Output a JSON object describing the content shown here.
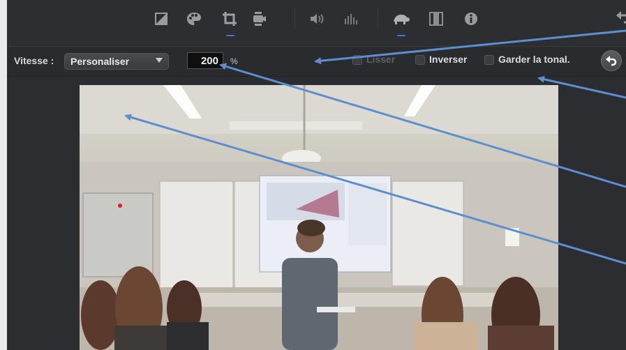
{
  "toolbar": {
    "icons": [
      "color-balance-icon",
      "color-palette-icon",
      "crop-icon",
      "stabilization-camera-icon",
      "volume-icon",
      "equalizer-icon",
      "speed-turtle-icon",
      "clip-filter-icon",
      "info-icon",
      "undo-icon"
    ],
    "active_tool": "speed-turtle-icon"
  },
  "speed": {
    "label": "Vitesse :",
    "mode": "Personaliser",
    "value": "200",
    "unit": "%",
    "smooth_label": "Lisser",
    "reverse_label": "Inverser",
    "preserve_pitch_label": "Garder la tonal."
  },
  "colors": {
    "accent": "#3b79d6",
    "annotation_arrow": "#5b8fd0",
    "background": "#2c2d31"
  }
}
